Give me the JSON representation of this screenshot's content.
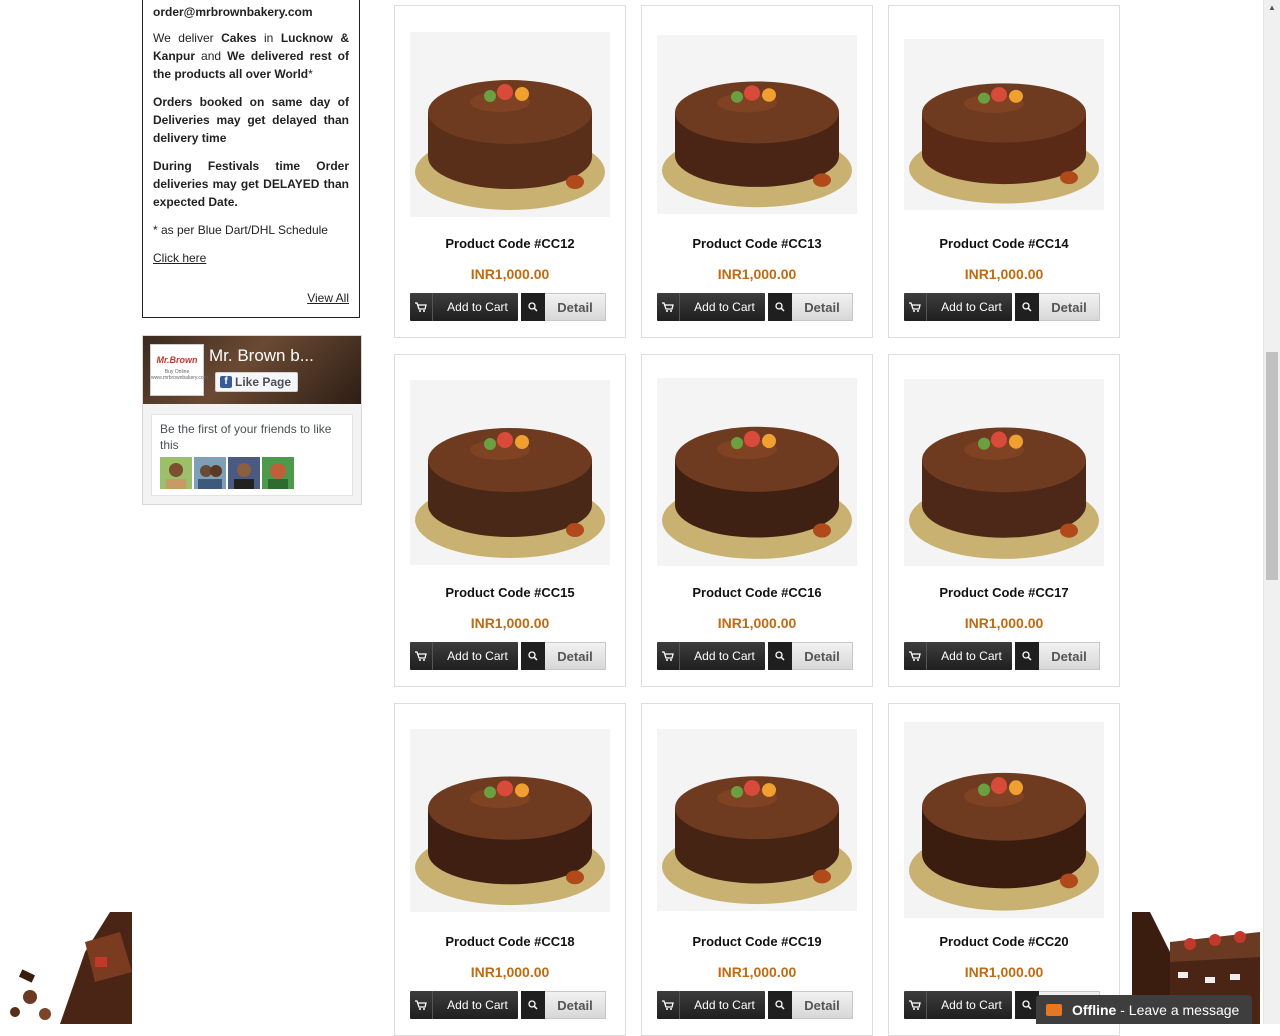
{
  "sidebar": {
    "email": "order@mrbrownbakery.com",
    "deliver_line": {
      "w1": "We deliver",
      "b1": "Cakes",
      "w2": "in",
      "b2": "Lucknow & Kanpur",
      "w3": "and",
      "b3": "We delivered rest of the products all over World",
      "star": "*"
    },
    "same_day_note": "Orders booked on same day of Deliveries may get delayed than delivery time",
    "festival_note": "During Festivals time Order deliveries may get DELAYED than expected Date.",
    "schedule_note": "* as per Blue Dart/DHL Schedule",
    "click_here": "Click here",
    "view_all": "View All"
  },
  "facebook": {
    "page_name": "Mr. Brown b...",
    "logo_text": "Mr.Brown",
    "logo_sub": "Buy Online www.mrbrownbakery.com",
    "like_label": "Like Page",
    "friends_text": "Be the first of your friends to like this"
  },
  "products": [
    {
      "code": "Product Code #CC12",
      "price": "INR1,000.00",
      "color": "#5a2f1a"
    },
    {
      "code": "Product Code #CC13",
      "price": "INR1,000.00",
      "color": "#4a2414"
    },
    {
      "code": "Product Code #CC14",
      "price": "INR1,000.00",
      "color": "#5b2a16"
    },
    {
      "code": "Product Code #CC15",
      "price": "INR1,000.00",
      "color": "#4a2817"
    },
    {
      "code": "Product Code #CC16",
      "price": "INR1,000.00",
      "color": "#3f2113"
    },
    {
      "code": "Product Code #CC17",
      "price": "INR1,000.00",
      "color": "#4d2818"
    },
    {
      "code": "Product Code #CC18",
      "price": "INR1,000.00",
      "color": "#3e1f12"
    },
    {
      "code": "Product Code #CC19",
      "price": "INR1,000.00",
      "color": "#452414"
    },
    {
      "code": "Product Code #CC20",
      "price": "INR1,000.00",
      "color": "#3b1d10"
    }
  ],
  "buttons": {
    "add_to_cart": "Add to Cart",
    "detail": "Detail"
  },
  "chat": {
    "status": "Offline",
    "message": " - Leave a message"
  }
}
